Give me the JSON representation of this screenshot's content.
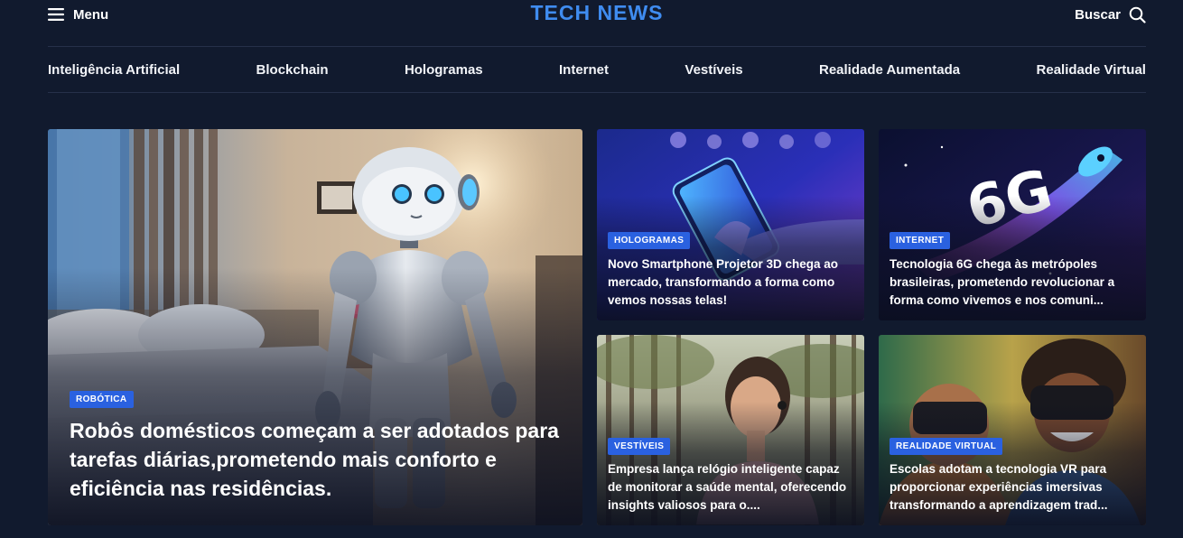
{
  "header": {
    "menu_label": "Menu",
    "logo": "TECH NEWS",
    "search_label": "Buscar"
  },
  "nav": {
    "items": [
      "Inteligência Artificial",
      "Blockchain",
      "Hologramas",
      "Internet",
      "Vestíveis",
      "Realidade Aumentada",
      "Realidade Virtual"
    ]
  },
  "featured": {
    "category": "ROBÓTICA",
    "headline": "Robôs domésticos começam a ser adotados para tarefas diárias,prometendo mais conforto e eficiência nas residências.",
    "image": "humanoid-robot-in-bedroom"
  },
  "articles": [
    {
      "category": "HOLOGRAMAS",
      "headline": "Novo Smartphone Projetor 3D chega ao mercado, transformando a forma como vemos nossas telas!",
      "image": "hand-holding-glowing-smartphone"
    },
    {
      "category": "INTERNET",
      "headline": "Tecnologia 6G chega às metrópoles brasileiras, prometendo revolucionar a forma como vivemos e nos comuni...",
      "image": "6g-rocket-graphic"
    },
    {
      "category": "VESTÍVEIS",
      "headline": "Empresa lança relógio inteligente capaz de monitorar a saúde mental, oferecendo insights valiosos para o....",
      "image": "woman-in-forest-with-earbuds"
    },
    {
      "category": "REALIDADE VIRTUAL",
      "headline": "Escolas adotam a tecnologia VR para proporcionar experiências imersivas transformando a aprendizagem trad...",
      "image": "children-wearing-vr-headsets"
    }
  ],
  "colors": {
    "background": "#111a2e",
    "logo": "#3f8cf0",
    "badge": "#2a61e0"
  }
}
